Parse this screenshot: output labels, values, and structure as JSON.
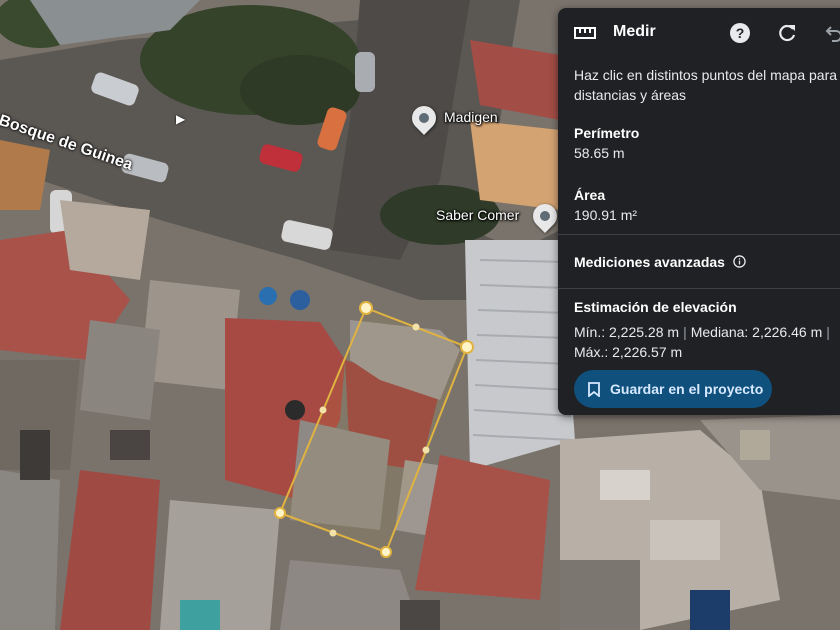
{
  "map": {
    "street_name": "Bosque de Guinea",
    "places": [
      {
        "name": "Madigen"
      },
      {
        "name": "Saber Comer"
      }
    ]
  },
  "panel": {
    "title": "Medir",
    "icons": [
      "ruler-icon",
      "help-icon",
      "reset-icon",
      "undo-icon"
    ],
    "instructions_line1": "Haz clic en distintos puntos del mapa para medir",
    "instructions_line2": "distancias y áreas",
    "perimeter_label": "Perímetro",
    "perimeter_value": "58.65 m",
    "area_label": "Área",
    "area_value": "190.91 m²",
    "advanced_label": "Mediciones avanzadas",
    "elevation_label": "Estimación de elevación",
    "elevation_min": "Mín.: 2,225.28 m",
    "elevation_median": "Mediana: 2,226.46 m",
    "elevation_max": "Máx.: 2,226.57 m",
    "save_button": "Guardar en el proyecto"
  },
  "colors": {
    "panel_bg": "#1f2124",
    "button_bg": "#10507d",
    "measure_line": "#e0b341"
  }
}
